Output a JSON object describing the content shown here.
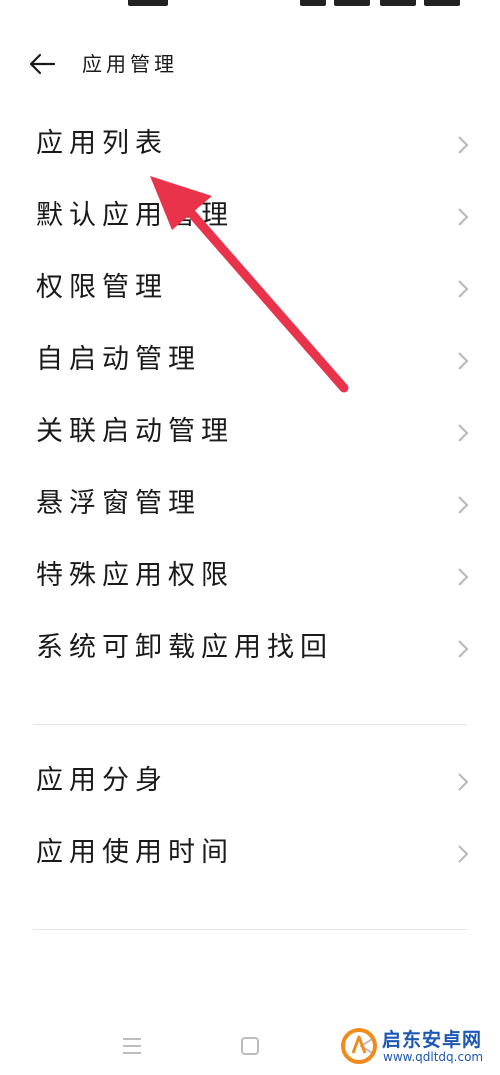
{
  "header": {
    "title": "应用管理"
  },
  "menu": {
    "group1": [
      {
        "label": "应用列表"
      },
      {
        "label": "默认应用管理"
      },
      {
        "label": "权限管理"
      },
      {
        "label": "自启动管理"
      },
      {
        "label": "关联启动管理"
      },
      {
        "label": "悬浮窗管理"
      },
      {
        "label": "特殊应用权限"
      },
      {
        "label": "系统可卸载应用找回"
      }
    ],
    "group2": [
      {
        "label": "应用分身"
      },
      {
        "label": "应用使用时间"
      }
    ]
  },
  "watermark": {
    "title": "启东安卓网",
    "url": "www.qdltdq.com"
  },
  "colors": {
    "annotation_arrow": "#e8334a",
    "chevron": "#b8b8b8",
    "divider": "#e6e6e6",
    "watermark_orange": "#f08c1e",
    "watermark_blue": "#1d57b6"
  },
  "icons": {
    "back": "back-arrow-icon",
    "chevron": "chevron-right-icon",
    "nav_menu": "menu-lines-icon",
    "nav_home": "home-square-icon",
    "nav_back": "back-triangle-icon"
  }
}
